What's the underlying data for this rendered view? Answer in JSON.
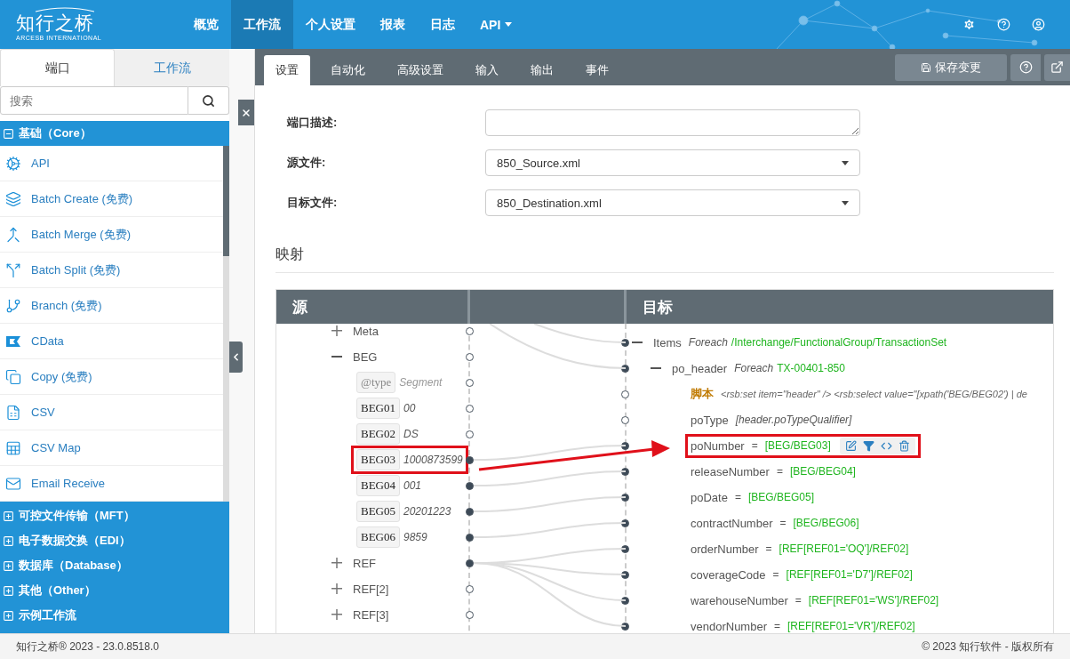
{
  "header": {
    "logo": "知行之桥",
    "tagline": "ARCESB INTERNATIONAL",
    "nav": [
      {
        "label": "概览",
        "selected": false,
        "dropdown": false
      },
      {
        "label": "工作流",
        "selected": true,
        "dropdown": false
      },
      {
        "label": "个人设置",
        "selected": false,
        "dropdown": false
      },
      {
        "label": "报表",
        "selected": false,
        "dropdown": false
      },
      {
        "label": "日志",
        "selected": false,
        "dropdown": false
      },
      {
        "label": "API",
        "selected": false,
        "dropdown": true
      }
    ]
  },
  "sidebar": {
    "tabs": [
      {
        "label": "端口",
        "selected": true
      },
      {
        "label": "工作流",
        "selected": false
      }
    ],
    "search": {
      "placeholder": "搜索"
    },
    "categories": [
      {
        "label": "基础（Core）",
        "expanded": true,
        "items": [
          {
            "label": "API",
            "kind": "api"
          },
          {
            "label": "Batch Create (免费)",
            "kind": "batch_create"
          },
          {
            "label": "Batch Merge (免费)",
            "kind": "batch_merge"
          },
          {
            "label": "Batch Split (免费)",
            "kind": "batch_split"
          },
          {
            "label": "Branch (免费)",
            "kind": "branch"
          },
          {
            "label": "CData",
            "kind": "cdata"
          },
          {
            "label": "Copy (免费)",
            "kind": "copy"
          },
          {
            "label": "CSV",
            "kind": "csv"
          },
          {
            "label": "CSV Map",
            "kind": "csv_map"
          },
          {
            "label": "Email Receive",
            "kind": "email"
          }
        ]
      },
      {
        "label": "可控文件传输（MFT）",
        "expanded": false
      },
      {
        "label": "电子数据交换（EDI）",
        "expanded": false
      },
      {
        "label": "数据库（Database）",
        "expanded": false
      },
      {
        "label": "其他（Other）",
        "expanded": false
      },
      {
        "label": "示例工作流",
        "expanded": false
      }
    ]
  },
  "main": {
    "tabs": [
      {
        "label": "设置",
        "selected": true
      },
      {
        "label": "自动化",
        "selected": false
      },
      {
        "label": "高级设置",
        "selected": false
      },
      {
        "label": "输入",
        "selected": false
      },
      {
        "label": "输出",
        "selected": false
      },
      {
        "label": "事件",
        "selected": false
      }
    ],
    "save_button": "保存变更"
  },
  "form": {
    "fields": [
      {
        "label": "端口描述:",
        "kind": "textarea"
      },
      {
        "label": "源文件:",
        "kind": "select",
        "value": "850_Source.xml"
      },
      {
        "label": "目标文件:",
        "kind": "select",
        "value": "850_Destination.xml"
      }
    ]
  },
  "mapping": {
    "title": "映射",
    "source_heading": "源",
    "target_heading": "目标",
    "source": [
      {
        "kind": "group",
        "name": "Meta",
        "expanded": false,
        "mapped": false
      },
      {
        "kind": "group",
        "name": "BEG",
        "expanded": true,
        "mapped": false,
        "children": [
          {
            "kind": "attribute",
            "name": "@type",
            "value": "Segment",
            "mapped": false,
            "highlighted": false
          },
          {
            "kind": "field",
            "name": "BEG01",
            "value": "00",
            "mapped": false,
            "highlighted": false
          },
          {
            "kind": "field",
            "name": "BEG02",
            "value": "DS",
            "mapped": false,
            "highlighted": false
          },
          {
            "kind": "field",
            "name": "BEG03",
            "value": "1000873599",
            "mapped": true,
            "highlighted": true
          },
          {
            "kind": "field",
            "name": "BEG04",
            "value": "001",
            "mapped": true,
            "highlighted": false
          },
          {
            "kind": "field",
            "name": "BEG05",
            "value": "20201223",
            "mapped": true,
            "highlighted": false
          },
          {
            "kind": "field",
            "name": "BEG06",
            "value": "9859",
            "mapped": true,
            "highlighted": false
          }
        ]
      },
      {
        "kind": "group",
        "name": "REF",
        "expanded": false,
        "mapped": true
      },
      {
        "kind": "group",
        "name": "REF[2]",
        "expanded": false,
        "mapped": false
      },
      {
        "kind": "group",
        "name": "REF[3]",
        "expanded": false,
        "mapped": false
      }
    ],
    "target": [
      {
        "kind": "loop",
        "name": "Items",
        "keyword": "Foreach",
        "value": "/Interchange/FunctionalGroup/TransactionSet",
        "expanded": true,
        "mapped": true,
        "children": [
          {
            "kind": "loop",
            "name": "po_header",
            "keyword": "Foreach",
            "value": "TX-00401-850",
            "expanded": true,
            "mapped": true,
            "children": [
              {
                "kind": "script",
                "name": "脚本",
                "value": "<rsb:set item=\"header\" /> <rsb:select value=\"[xpath('BEG/BEG02') | de",
                "mapped": false
              },
              {
                "kind": "expression",
                "name": "poType",
                "value": "[header.poTypeQualifier]",
                "mapped": false
              },
              {
                "kind": "mapping",
                "name": "poNumber",
                "op": "=",
                "value": "[BEG/BEG03]",
                "mapped": true,
                "highlighted": true,
                "show_actions": true
              },
              {
                "kind": "mapping",
                "name": "releaseNumber",
                "op": "=",
                "value": "[BEG/BEG04]",
                "mapped": true,
                "highlighted": false,
                "show_actions": false
              },
              {
                "kind": "mapping",
                "name": "poDate",
                "op": "=",
                "value": "[BEG/BEG05]",
                "mapped": true,
                "highlighted": false,
                "show_actions": false
              },
              {
                "kind": "mapping",
                "name": "contractNumber",
                "op": "=",
                "value": "[BEG/BEG06]",
                "mapped": true,
                "highlighted": false,
                "show_actions": false
              },
              {
                "kind": "mapping",
                "name": "orderNumber",
                "op": "=",
                "value": "[REF[REF01='OQ']/REF02]",
                "mapped": true,
                "highlighted": false,
                "show_actions": false
              },
              {
                "kind": "mapping",
                "name": "coverageCode",
                "op": "=",
                "value": "[REF[REF01='D7']/REF02]",
                "mapped": true,
                "highlighted": false,
                "show_actions": false
              },
              {
                "kind": "mapping",
                "name": "warehouseNumber",
                "op": "=",
                "value": "[REF[REF01='WS']/REF02]",
                "mapped": true,
                "highlighted": false,
                "show_actions": false
              },
              {
                "kind": "mapping",
                "name": "vendorNumber",
                "op": "=",
                "value": "[REF[REF01='VR']/REF02]",
                "mapped": true,
                "highlighted": false,
                "show_actions": false
              }
            ]
          }
        ]
      }
    ]
  },
  "footer": {
    "version": "知行之桥® 2023 - 23.0.8518.0",
    "copyright": "© 2023 知行软件 - 版权所有"
  }
}
